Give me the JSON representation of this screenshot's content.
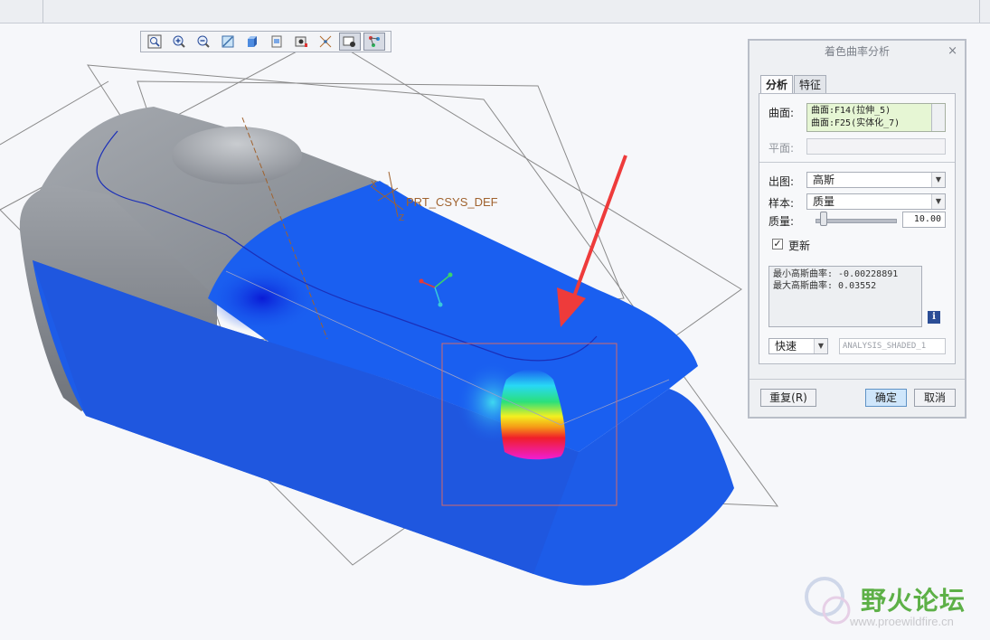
{
  "viewport": {
    "csys_label": "PRT_CSYS_DEF",
    "axis_x": "X",
    "axis_z": "Z"
  },
  "toolbar": {
    "buttons": [
      {
        "icon": "zoom-fit-icon"
      },
      {
        "icon": "zoom-in-icon"
      },
      {
        "icon": "zoom-out-icon"
      },
      {
        "icon": "repaint-icon"
      },
      {
        "icon": "display-style-icon"
      },
      {
        "icon": "saved-views-icon"
      },
      {
        "icon": "view-manager-icon"
      },
      {
        "icon": "datum-display-icon"
      },
      {
        "icon": "annotation-display-icon",
        "pressed": true
      },
      {
        "icon": "analysis-display-icon",
        "pressed": true
      }
    ]
  },
  "dialog": {
    "title": "着色曲率分析",
    "close": "×",
    "tabs": [
      "分析",
      "特征"
    ],
    "surface_label": "曲面:",
    "surfaces": [
      "曲面:F14(拉伸_5)",
      "曲面:F25(实体化_7)"
    ],
    "plane_label": "平面:",
    "plane_value": "",
    "output_label": "出图:",
    "output_value": "高斯",
    "sample_label": "样本:",
    "sample_value": "质量",
    "quality_label": "质量:",
    "quality_value": "10.00",
    "quality_level": 0.08,
    "update_label": "更新",
    "update_checked": true,
    "result_lines": [
      "最小高斯曲率: -0.00228891",
      "最大高斯曲率: 0.03552"
    ],
    "info": "i",
    "quick_value": "快速",
    "analysis_name": "ANALYSIS_SHADED_1",
    "repeat_button": "重复(R)",
    "ok_button": "确定",
    "cancel_button": "取消"
  },
  "watermark": {
    "cn": "野火论坛",
    "url": "www.proewildfire.cn"
  },
  "colors": {
    "surface_blue": "#1a5ff0",
    "gray_body": "#8d9198",
    "annotation_red": "#ee3b3b",
    "highlight_box": "#d36a6a"
  }
}
